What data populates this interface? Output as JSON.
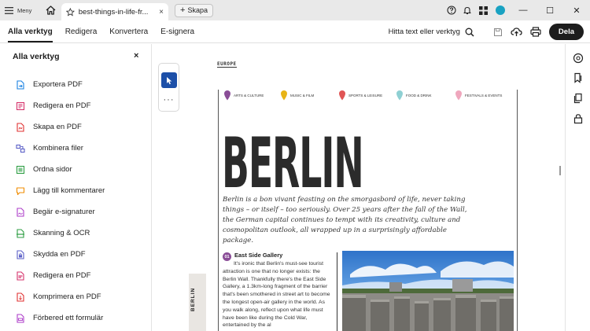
{
  "titlebar": {
    "menu_label": "Meny",
    "tab_title": "best-things-in-life-fr...",
    "tab_close": "×",
    "create_label": "Skapa",
    "minimize": "—",
    "maximize": "☐",
    "close": "✕",
    "avatar_color": "#19a2c2"
  },
  "toolbar": {
    "nav": [
      "Alla verktyg",
      "Redigera",
      "Konvertera",
      "E-signera"
    ],
    "find_text": "Hitta text eller verktyg",
    "share_label": "Dela"
  },
  "panel": {
    "title": "Alla verktyg",
    "close": "×",
    "tools": [
      {
        "label": "Exportera PDF",
        "icon": "export-pdf-icon",
        "color": "#1a82e2"
      },
      {
        "label": "Redigera en PDF",
        "icon": "edit-pdf-icon",
        "color": "#d6336c"
      },
      {
        "label": "Skapa en PDF",
        "icon": "create-pdf-icon",
        "color": "#e03131"
      },
      {
        "label": "Kombinera filer",
        "icon": "combine-files-icon",
        "color": "#5b5fc7"
      },
      {
        "label": "Ordna sidor",
        "icon": "organize-pages-icon",
        "color": "#2f9e44"
      },
      {
        "label": "Lägg till kommentarer",
        "icon": "comment-icon",
        "color": "#f08c00"
      },
      {
        "label": "Begär e-signaturer",
        "icon": "request-signature-icon",
        "color": "#ae3ec9"
      },
      {
        "label": "Skanning & OCR",
        "icon": "scan-ocr-icon",
        "color": "#2f9e44"
      },
      {
        "label": "Skydda en PDF",
        "icon": "protect-pdf-icon",
        "color": "#5b5fc7"
      },
      {
        "label": "Redigera en PDF",
        "icon": "redact-pdf-icon",
        "color": "#d6336c"
      },
      {
        "label": "Komprimera en PDF",
        "icon": "compress-pdf-icon",
        "color": "#e03131"
      },
      {
        "label": "Förbered ett formulär",
        "icon": "prepare-form-icon",
        "color": "#ae3ec9"
      }
    ]
  },
  "mini_tools": {
    "more": "···"
  },
  "document": {
    "page_tag": "EUROPE",
    "categories": [
      {
        "label": "ARTS & CULTURE",
        "color": "#8a4d97"
      },
      {
        "label": "MUSIC & FILM",
        "color": "#e8b417"
      },
      {
        "label": "SPORTS & LEISURE",
        "color": "#e05555"
      },
      {
        "label": "FOOD & DRINK",
        "color": "#8fd0d3"
      },
      {
        "label": "FESTIVALS & EVENTS",
        "color": "#efa7bd"
      }
    ],
    "city": "BERLIN",
    "intro": "Berlin is a bon vivant feasting on the smorgasbord of life, never taking things – or itself – too seriously. Over 25 years after the fall of the Wall, the German capital continues to tempt with its creativity, culture and cosmopolitan outlook, all wrapped up in a surprisingly affordable package.",
    "side_label": "BERLIN",
    "section_number": "01",
    "section_title": "East Side Gallery",
    "section_body": "It's ironic that Berlin's must-see tourist attraction is one that no longer exists: the Berlin Wall. Thankfully there's the East Side Gallery, a 1.3km-long fragment of the barrier that's been smothered in street art to become the longest open-air gallery in the world. As you walk along, reflect upon what life must have been like during the Cold War, entertained by the al"
  }
}
